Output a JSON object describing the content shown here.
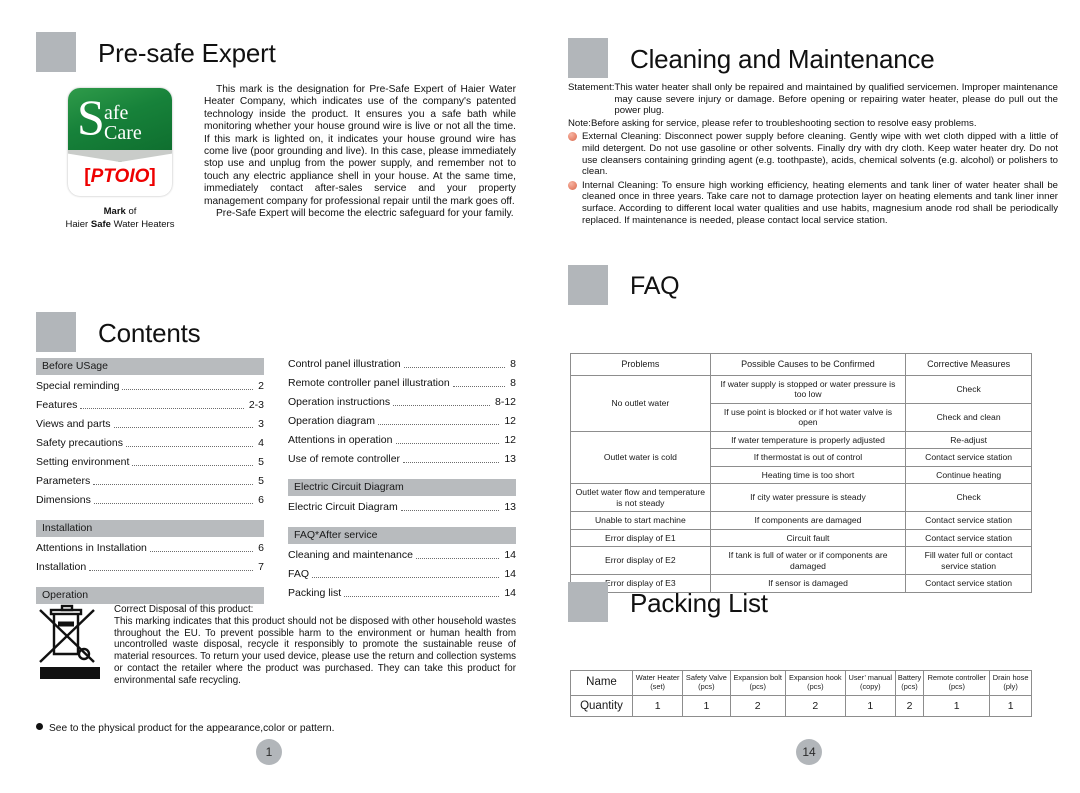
{
  "left_page": {
    "page_number": "1",
    "presafe": {
      "title": "Pre-safe Expert",
      "logo": {
        "letter_s": "S",
        "safe": "afe",
        "care": "Care",
        "ptoio": "PTOIO",
        "caption_line1_bold": "Mark",
        "caption_line1_rest": " of",
        "caption_line2_a": "Haier ",
        "caption_line2_bold": "Safe",
        "caption_line2_b": " Water Heaters"
      },
      "paragraph1": "This mark is the designation for Pre-Safe Expert of Haier Water Heater Company, which indicates use of the company's patented technology inside the product. It ensures you a safe bath while monitoring whether your house ground wire is live or not all the time. If this mark is lighted on, it indicates your house ground wire has come live (poor grounding and live). In this case, please immediately stop use and unplug from the power supply, and remember not to touch any electric appliance shell in your house. At the same time, immediately contact after-sales service and your property management company for professional repair until the mark goes off.",
      "paragraph2": "Pre-Safe Expert will become the electric safeguard for your family."
    },
    "contents": {
      "title": "Contents",
      "left_column": [
        {
          "type": "bar",
          "label": "Before USage"
        },
        {
          "type": "item",
          "label": "Special reminding",
          "page": "2"
        },
        {
          "type": "item",
          "label": "Features",
          "page": "2-3"
        },
        {
          "type": "item",
          "label": "Views and parts",
          "page": "3"
        },
        {
          "type": "item",
          "label": "Safety precautions",
          "page": "4"
        },
        {
          "type": "item",
          "label": "Setting environment",
          "page": "5"
        },
        {
          "type": "item",
          "label": "Parameters",
          "page": "5"
        },
        {
          "type": "item",
          "label": "Dimensions",
          "page": "6"
        },
        {
          "type": "bar",
          "label": "Installation"
        },
        {
          "type": "item",
          "label": "Attentions in Installation",
          "page": "6"
        },
        {
          "type": "item",
          "label": "Installation",
          "page": "7"
        },
        {
          "type": "bar",
          "label": "Operation"
        }
      ],
      "right_column": [
        {
          "type": "item",
          "label": "Control panel illustration",
          "page": "8"
        },
        {
          "type": "item",
          "label": "Remote controller panel illustration",
          "page": "8"
        },
        {
          "type": "item",
          "label": "Operation instructions",
          "page": "8-12"
        },
        {
          "type": "item",
          "label": "Operation diagram",
          "page": "12"
        },
        {
          "type": "item",
          "label": "Attentions in operation",
          "page": "12"
        },
        {
          "type": "item",
          "label": "Use of remote controller",
          "page": "13"
        },
        {
          "type": "bar",
          "label": "Electric Circuit Diagram"
        },
        {
          "type": "item",
          "label": "Electric Circuit Diagram",
          "page": "13"
        },
        {
          "type": "bar",
          "label": "FAQ*After service"
        },
        {
          "type": "item",
          "label": "Cleaning and maintenance",
          "page": "14"
        },
        {
          "type": "item",
          "label": "FAQ",
          "page": "14"
        },
        {
          "type": "item",
          "label": "Packing list",
          "page": "14"
        }
      ]
    },
    "weee": {
      "heading": "Correct Disposal of this product:",
      "body": "This marking indicates that this product should not be disposed with other household wastes throughout the EU. To prevent possible harm to the environment or human health from uncontrolled waste disposal, recycle it responsibly to promote the sustainable reuse of material resources. To return your used device, please use the return and collection systems or contact the retailer where the product was purchased. They can take this product for environmental safe recycling."
    },
    "footnote": "See to the physical product for the appearance,color or pattern."
  },
  "right_page": {
    "page_number": "14",
    "cleaning": {
      "title": "Cleaning and Maintenance",
      "statement_tag": "Statement:",
      "statement_body": "This water heater shall only be repaired and maintained by qualified servicemen. Improper maintenance may cause severe injury or damage. Before opening or repairing water heater, please do pull out the power plug.",
      "note_tag": "Note:",
      "note_body": "Before asking for service, please refer to troubleshooting section to resolve easy problems.",
      "bullets": [
        "External Cleaning: Disconnect power supply before cleaning. Gently wipe with wet cloth dipped with a little of mild detergent. Do not use gasoline or other solvents. Finally dry with dry cloth. Keep water heater dry. Do not use cleansers containing grinding agent (e.g. toothpaste), acids, chemical solvents (e.g. alcohol) or polishers to clean.",
        "Internal Cleaning: To ensure high working efficiency, heating elements and tank liner of water heater shall be cleaned once in three years. Take care not to damage protection layer on heating elements and tank liner inner surface. According to different local water qualities and use habits, magnesium anode rod shall be periodically replaced. If maintenance is needed, please contact local service station."
      ]
    },
    "faq": {
      "title": "FAQ",
      "headers": [
        "Problems",
        "Possible Causes to be Confirmed",
        "Corrective Measures"
      ],
      "rows": [
        {
          "problem": "No outlet water",
          "problem_rowspan": 2,
          "cause": "If water supply is stopped or water pressure is too low",
          "cause_align": "left",
          "measure": "Check"
        },
        {
          "cause": "If use point is blocked or if hot water valve is open",
          "cause_align": "left",
          "measure": "Check and clean"
        },
        {
          "problem": "Outlet water is cold",
          "problem_rowspan": 3,
          "cause": "If water temperature is properly adjusted",
          "cause_align": "center",
          "measure": "Re-adjust"
        },
        {
          "cause": "If thermostat is out of control",
          "cause_align": "center",
          "measure": "Contact service station"
        },
        {
          "cause": "Heating time is too short",
          "cause_align": "center",
          "measure": "Continue heating"
        },
        {
          "problem": "Outlet water flow and temperature is not steady",
          "problem_rowspan": 1,
          "problem_align": "left",
          "cause": "If city water pressure is steady",
          "cause_align": "center",
          "measure": "Check"
        },
        {
          "problem": "Unable to start machine",
          "problem_rowspan": 1,
          "cause": "If components are damaged",
          "cause_align": "center",
          "measure": "Contact service station"
        },
        {
          "problem": "Error display of E1",
          "problem_rowspan": 1,
          "cause": "Circuit fault",
          "cause_align": "center",
          "measure": "Contact service station"
        },
        {
          "problem": "Error display of E2",
          "problem_rowspan": 1,
          "cause": "If tank is full of water or if components are damaged",
          "cause_align": "left",
          "measure": "Fill water full or contact service station",
          "measure_align": "left"
        },
        {
          "problem": "Error display of E3",
          "problem_rowspan": 1,
          "cause": "If sensor is damaged",
          "cause_align": "center",
          "measure": "Contact service station"
        }
      ]
    },
    "packing": {
      "title": "Packing List",
      "row_headers": [
        "Name",
        "Quantity"
      ],
      "items": [
        {
          "name": "Water Heater",
          "unit": "(set)",
          "qty": "1"
        },
        {
          "name": "Safety Valve",
          "unit": "(pcs)",
          "qty": "1"
        },
        {
          "name": "Expansion bolt",
          "unit": "(pcs)",
          "qty": "2"
        },
        {
          "name": "Expansion hook",
          "unit": "(pcs)",
          "qty": "2"
        },
        {
          "name": "User’ manual",
          "unit": "(copy)",
          "qty": "1"
        },
        {
          "name": "Battery",
          "unit": "(pcs)",
          "qty": "2"
        },
        {
          "name": "Remote controller",
          "unit": "(pcs)",
          "qty": "1"
        },
        {
          "name": "Drain hose",
          "unit": "(ply)",
          "qty": "1"
        }
      ]
    }
  },
  "colors": {
    "grey_square": "#b2b6ba",
    "toc_bar": "#b8bbbe",
    "bullet": "#e98a72",
    "logo_green": "#17823a",
    "logo_red": "#ee0000",
    "rule": "#8d8d8d"
  }
}
